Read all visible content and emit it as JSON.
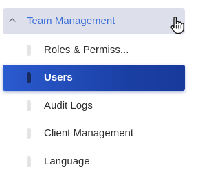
{
  "group": {
    "label": "Team Management",
    "chevron_icon": "chevron-up-icon",
    "accent_color": "#3d6fd8",
    "expanded": true
  },
  "items": [
    {
      "label": "Roles & Permiss...",
      "icon": "item-marker",
      "active": false
    },
    {
      "label": "Users",
      "icon": "item-marker",
      "active": true
    },
    {
      "label": "Audit Logs",
      "icon": "item-marker",
      "active": false
    },
    {
      "label": "Client Management",
      "icon": "item-marker",
      "active": false
    },
    {
      "label": "Language",
      "icon": "item-marker",
      "active": false
    }
  ],
  "colors": {
    "header_bg": "#dde0ea",
    "active_bg": "#1f47b5",
    "text": "#2b2b2b",
    "marker": "#e4e4e4"
  },
  "cursor_icon": "hand-pointer-icon"
}
